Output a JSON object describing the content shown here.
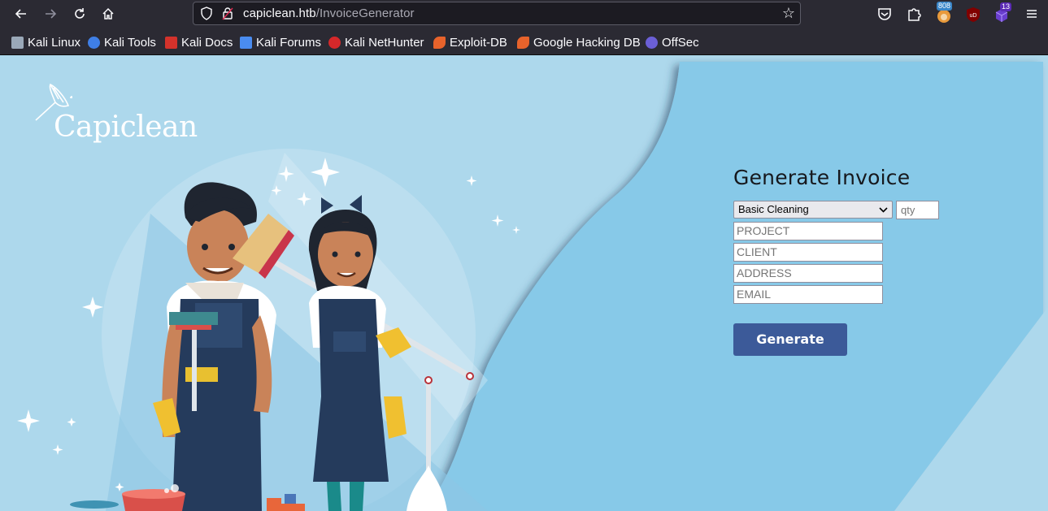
{
  "browser": {
    "url_host": "capiclean.htb",
    "url_path": "/InvoiceGenerator",
    "badges": {
      "extension_count": "808",
      "notifications_count": "13"
    },
    "bookmarks": [
      {
        "label": "Kali Linux",
        "icon": "kali-linux-icon",
        "color": "#9aa8b8"
      },
      {
        "label": "Kali Tools",
        "icon": "kali-tools-icon",
        "color": "#3f7fe6"
      },
      {
        "label": "Kali Docs",
        "icon": "kali-docs-icon",
        "color": "#d3322b"
      },
      {
        "label": "Kali Forums",
        "icon": "kali-forums-icon",
        "color": "#4a8cf0"
      },
      {
        "label": "Kali NetHunter",
        "icon": "kali-nethunter-icon",
        "color": "#d6282a"
      },
      {
        "label": "Exploit-DB",
        "icon": "exploit-db-icon",
        "color": "#e8632b"
      },
      {
        "label": "Google Hacking DB",
        "icon": "google-hacking-db-icon",
        "color": "#e8632b"
      },
      {
        "label": "OffSec",
        "icon": "offsec-icon",
        "color": "#6b5fd6"
      }
    ]
  },
  "page": {
    "logo_text": "Capiclean",
    "form": {
      "title": "Generate Invoice",
      "service_select_value": "Basic Cleaning",
      "qty_placeholder": "qty",
      "project_placeholder": "PROJECT",
      "client_placeholder": "CLIENT",
      "address_placeholder": "ADDRESS",
      "email_placeholder": "EMAIL",
      "generate_label": "Generate"
    },
    "colors": {
      "background": "#add8ec",
      "panel": "#87c9e8",
      "button": "#3c5a99"
    }
  }
}
